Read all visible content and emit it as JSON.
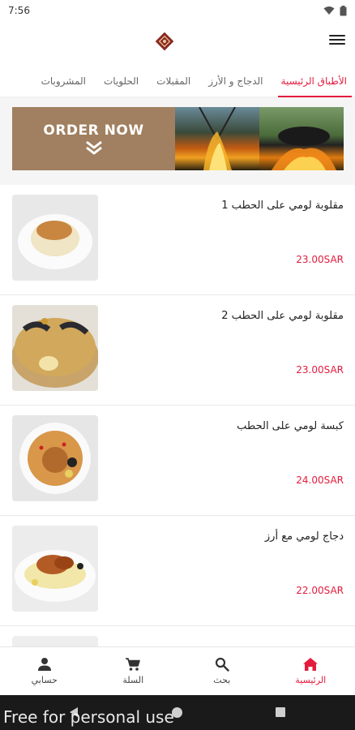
{
  "status_bar": {
    "time": "7:56"
  },
  "tabs": [
    {
      "label": "الأطباق الرئيسية",
      "active": true
    },
    {
      "label": "الدجاج و الأرز",
      "active": false
    },
    {
      "label": "المقبلات",
      "active": false
    },
    {
      "label": "الحلويات",
      "active": false
    },
    {
      "label": "المشروبات",
      "active": false
    }
  ],
  "banner": {
    "text": "ORDER NOW"
  },
  "products": [
    {
      "name": "مقلوبة لومي على الحطب 1",
      "price": "23.00SAR"
    },
    {
      "name": "مقلوبة لومي على الحطب 2",
      "price": "23.00SAR"
    },
    {
      "name": "كبسة لومي على الحطب",
      "price": "24.00SAR"
    },
    {
      "name": "دجاج لومي مع أرز",
      "price": "22.00SAR"
    }
  ],
  "bottom_nav": [
    {
      "label": "الرئيسية",
      "icon": "home-icon",
      "active": true
    },
    {
      "label": "بحث",
      "icon": "search-icon",
      "active": false
    },
    {
      "label": "السلة",
      "icon": "cart-icon",
      "active": false
    },
    {
      "label": "حسابي",
      "icon": "user-icon",
      "active": false
    }
  ],
  "watermark": "Free for personal use",
  "colors": {
    "accent": "#e31c3d",
    "banner_bg": "#a08060"
  }
}
